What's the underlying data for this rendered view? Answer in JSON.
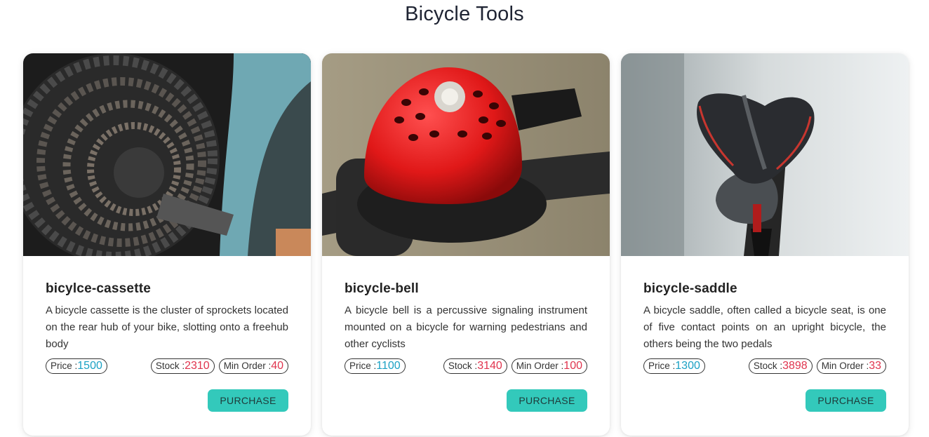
{
  "page": {
    "title": "Bicycle Tools"
  },
  "labels": {
    "price": "Price :",
    "stock": "Stock :",
    "min_order": "Min Order :",
    "purchase": "PURCHASE"
  },
  "products": [
    {
      "name": "bicylce-cassette",
      "description": "A bicycle cassette is the cluster of sprockets located on the rear hub of your bike, slotting onto a freehub body",
      "price": "1500",
      "stock": "2310",
      "min_order": "40"
    },
    {
      "name": "bicycle-bell",
      "description": "A bicycle bell is a percussive signaling instrument mounted on a bicycle for warning pedestrians and other cyclists",
      "price": "1100",
      "stock": "3140",
      "min_order": "100"
    },
    {
      "name": "bicycle-saddle",
      "description": "A bicycle saddle, often called a bicycle seat, is one of five contact points on an upright bicycle, the others being the two pedals",
      "price": "1300",
      "stock": "3898",
      "min_order": "33"
    }
  ],
  "colors": {
    "accent": "#33c9bb",
    "price": "#1ba1c4",
    "stock": "#e0344e"
  }
}
